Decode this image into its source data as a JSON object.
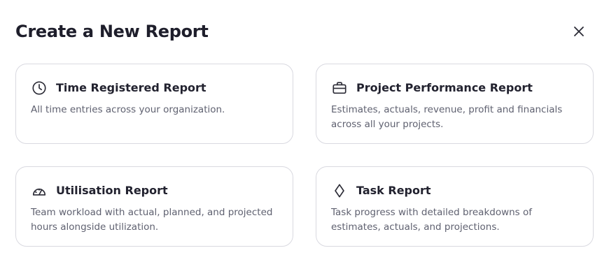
{
  "dialog": {
    "title": "Create a New Report",
    "close_icon": "close-icon"
  },
  "reports": [
    {
      "icon": "clock-icon",
      "title": "Time Registered Report",
      "description": "All time entries across your organization."
    },
    {
      "icon": "briefcase-icon",
      "title": "Project Performance Report",
      "description": "Estimates, actuals, revenue, profit and financials across all your projects."
    },
    {
      "icon": "gauge-icon",
      "title": "Utilisation Report",
      "description": "Team workload with actual, planned, and projected hours alongside utilization."
    },
    {
      "icon": "diamond-icon",
      "title": "Task Report",
      "description": "Task progress with detailed breakdowns of estimates, actuals, and projections."
    }
  ]
}
